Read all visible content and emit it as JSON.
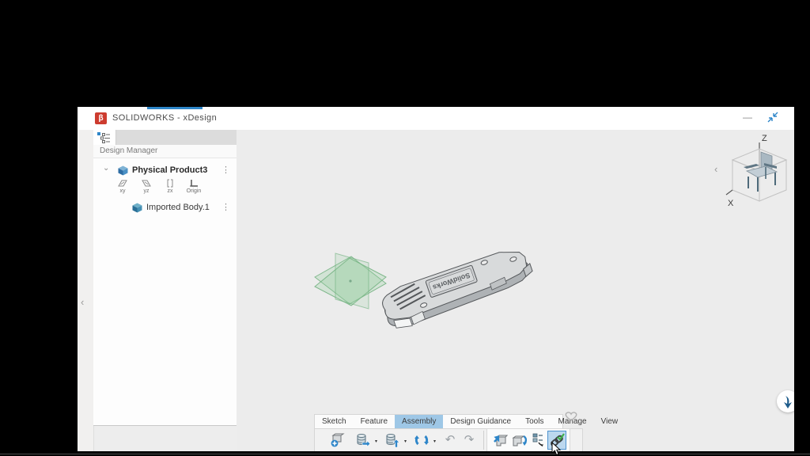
{
  "titlebar": {
    "title": "SOLIDWORKS - xDesign",
    "logo": "β",
    "minimize_glyph": "—"
  },
  "rail": {
    "collapse_glyph": "‹"
  },
  "design_manager": {
    "header": "Design Manager",
    "root": {
      "label": "Physical Product3",
      "expand_glyph": "⌄",
      "menu_glyph": "⋮"
    },
    "planes": [
      {
        "label": "xy"
      },
      {
        "label": "yz"
      },
      {
        "label": "zx"
      },
      {
        "label": "Origin"
      }
    ],
    "items": [
      {
        "label": "Imported Body.1",
        "menu_glyph": "⋮"
      }
    ]
  },
  "viewport": {
    "model_engraving": "SolidWorks",
    "viewcube": {
      "top_axis": "Z",
      "left_axis": "X",
      "collapse_glyph": "‹"
    }
  },
  "ribbon": {
    "tabs": [
      {
        "label": "Sketch"
      },
      {
        "label": "Feature"
      },
      {
        "label": "Assembly"
      },
      {
        "label": "Design Guidance"
      },
      {
        "label": "Tools"
      },
      {
        "label": "Manage"
      },
      {
        "label": "View"
      }
    ],
    "active_tab": "Assembly",
    "left_tools": [
      "insert-new-component",
      "open-from-database",
      "save-to-database",
      "update",
      "undo",
      "redo"
    ],
    "right_tools": [
      "insert-component",
      "replace-component",
      "component-pattern",
      "mate"
    ],
    "selected_tool": "mate",
    "undo_glyph": "↶",
    "redo_glyph": "↷",
    "dropdown_glyph": "▾"
  },
  "colors": {
    "accent_blue": "#2e86c9",
    "active_tab_bg": "#9ec7e6",
    "selected_tool_border": "#4f93cf",
    "plane_green": "#7ab98a",
    "logo_red": "#cd3c2f"
  }
}
